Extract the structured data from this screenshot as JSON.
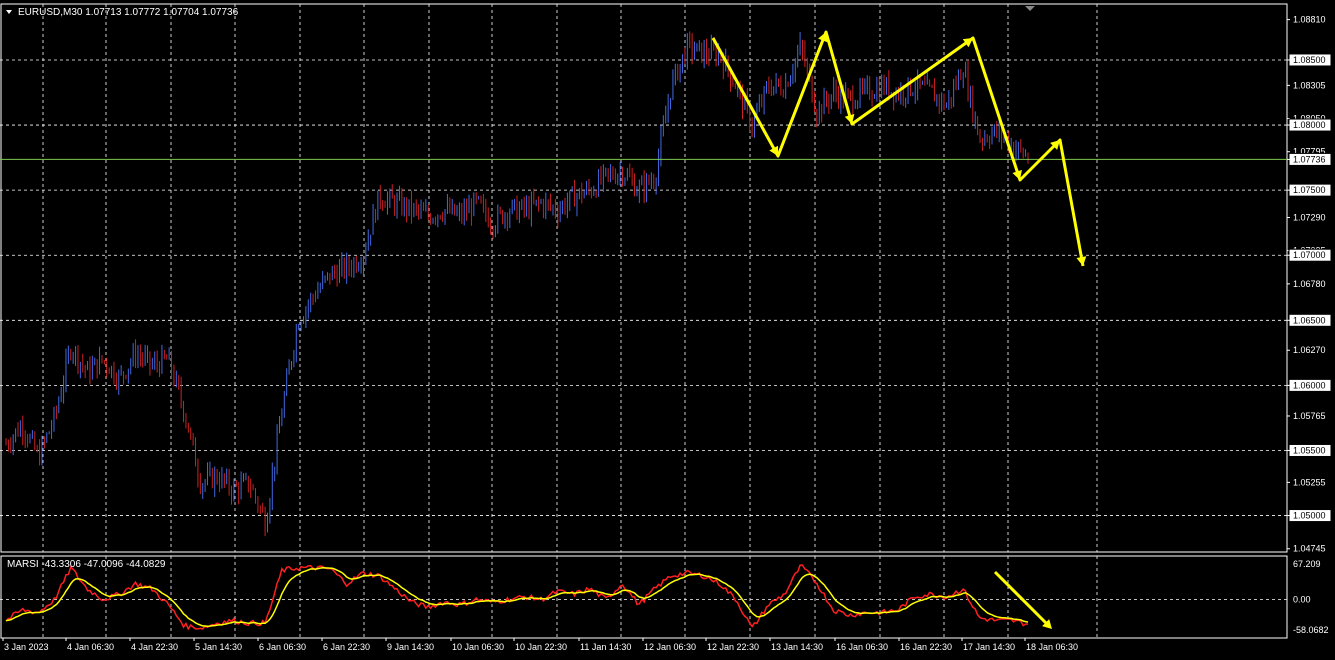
{
  "window": {
    "symbol_title": "EURUSD,M30",
    "ohlc": "1.07713 1.07772 1.07704 1.07736"
  },
  "colors": {
    "background": "#000000",
    "grid": "#ffffff",
    "bull_candle": "#4169e1",
    "bear_candle": "#cc2222",
    "price_line": "#7ec850",
    "annotation": "#ffff00",
    "osc_main": "#ff2020",
    "osc_signal": "#ffff00"
  },
  "price_axis": {
    "labels": [
      "1.08810",
      "1.08500",
      "1.08305",
      "1.08050",
      "1.08000",
      "1.07795",
      "1.07736",
      "1.07500",
      "1.07290",
      "1.07035",
      "1.07000",
      "1.06780",
      "1.06500",
      "1.06270",
      "1.06000",
      "1.05765",
      "1.05500",
      "1.05255",
      "1.05000",
      "1.04745"
    ],
    "current_price": "1.07736"
  },
  "oscillator": {
    "title": "MARSI",
    "values_text": "-43.3306 -47.0096 -44.0829",
    "axis_labels": [
      "67.209",
      "0.00",
      "-58.0682"
    ]
  },
  "time_axis": {
    "labels": [
      "3 Jan 2023",
      "4 Jan 06:30",
      "4 Jan 22:30",
      "5 Jan 14:30",
      "6 Jan 06:30",
      "6 Jan 22:30",
      "9 Jan 14:30",
      "10 Jan 06:30",
      "10 Jan 22:30",
      "11 Jan 14:30",
      "12 Jan 06:30",
      "12 Jan 22:30",
      "13 Jan 14:30",
      "16 Jan 06:30",
      "16 Jan 22:30",
      "17 Jan 14:30",
      "18 Jan 06:30"
    ]
  },
  "chart_data": {
    "type": "candlestick",
    "symbol": "EURUSD",
    "timeframe": "M30",
    "ylim": [
      1.0472,
      1.0893
    ],
    "price_path": [
      {
        "t": "3 Jan 2023",
        "price": 1.0555
      },
      {
        "t": "",
        "price": 1.057
      },
      {
        "t": "",
        "price": 1.0545
      },
      {
        "t": "",
        "price": 1.0575
      },
      {
        "t": "4 Jan 06:30",
        "price": 1.063
      },
      {
        "t": "",
        "price": 1.061
      },
      {
        "t": "",
        "price": 1.062
      },
      {
        "t": "",
        "price": 1.0605
      },
      {
        "t": "4 Jan 22:30",
        "price": 1.0625
      },
      {
        "t": "",
        "price": 1.0615
      },
      {
        "t": "",
        "price": 1.062
      },
      {
        "t": "",
        "price": 1.058
      },
      {
        "t": "5 Jan 14:30",
        "price": 1.0525
      },
      {
        "t": "",
        "price": 1.053
      },
      {
        "t": "",
        "price": 1.052
      },
      {
        "t": "",
        "price": 1.0525
      },
      {
        "t": "6 Jan 06:30",
        "price": 1.0495
      },
      {
        "t": "",
        "price": 1.058
      },
      {
        "t": "",
        "price": 1.065
      },
      {
        "t": "",
        "price": 1.067
      },
      {
        "t": "6 Jan 22:30",
        "price": 1.0685
      },
      {
        "t": "",
        "price": 1.069
      },
      {
        "t": "",
        "price": 1.07
      },
      {
        "t": "",
        "price": 1.0745
      },
      {
        "t": "9 Jan 14:30",
        "price": 1.074
      },
      {
        "t": "",
        "price": 1.0735
      },
      {
        "t": "",
        "price": 1.073
      },
      {
        "t": "",
        "price": 1.0735
      },
      {
        "t": "10 Jan 06:30",
        "price": 1.073
      },
      {
        "t": "",
        "price": 1.074
      },
      {
        "t": "",
        "price": 1.0725
      },
      {
        "t": "",
        "price": 1.0735
      },
      {
        "t": "10 Jan 22:30",
        "price": 1.0735
      },
      {
        "t": "",
        "price": 1.074
      },
      {
        "t": "",
        "price": 1.0735
      },
      {
        "t": "",
        "price": 1.0745
      },
      {
        "t": "11 Jan 14:30",
        "price": 1.075
      },
      {
        "t": "",
        "price": 1.076
      },
      {
        "t": "",
        "price": 1.0765
      },
      {
        "t": "",
        "price": 1.075
      },
      {
        "t": "12 Jan 06:30",
        "price": 1.076
      },
      {
        "t": "",
        "price": 1.083
      },
      {
        "t": "",
        "price": 1.086
      },
      {
        "t": "",
        "price": 1.0855
      },
      {
        "t": "12 Jan 22:30",
        "price": 1.0855
      },
      {
        "t": "",
        "price": 1.083
      },
      {
        "t": "",
        "price": 1.08
      },
      {
        "t": "",
        "price": 1.083
      },
      {
        "t": "13 Jan 14:30",
        "price": 1.083
      },
      {
        "t": "",
        "price": 1.086
      },
      {
        "t": "",
        "price": 1.081
      },
      {
        "t": "",
        "price": 1.0825
      },
      {
        "t": "16 Jan 06:30",
        "price": 1.082
      },
      {
        "t": "",
        "price": 1.0825
      },
      {
        "t": "",
        "price": 1.083
      },
      {
        "t": "",
        "price": 1.0825
      },
      {
        "t": "16 Jan 22:30",
        "price": 1.083
      },
      {
        "t": "",
        "price": 1.0825
      },
      {
        "t": "",
        "price": 1.0815
      },
      {
        "t": "",
        "price": 1.0845
      },
      {
        "t": "17 Jan 14:30",
        "price": 1.079
      },
      {
        "t": "",
        "price": 1.0795
      },
      {
        "t": "",
        "price": 1.0785
      },
      {
        "t": "",
        "price": 1.0775
      }
    ],
    "oscillator_path": [
      {
        "t": "3 Jan 2023",
        "value": -40
      },
      {
        "t": "",
        "value": -20
      },
      {
        "t": "",
        "value": -25
      },
      {
        "t": "",
        "value": 0
      },
      {
        "t": "4 Jan 06:30",
        "value": 60
      },
      {
        "t": "",
        "value": 20
      },
      {
        "t": "",
        "value": 0
      },
      {
        "t": "",
        "value": 10
      },
      {
        "t": "4 Jan 22:30",
        "value": 30
      },
      {
        "t": "",
        "value": 20
      },
      {
        "t": "",
        "value": -10
      },
      {
        "t": "",
        "value": -50
      },
      {
        "t": "5 Jan 14:30",
        "value": -55
      },
      {
        "t": "",
        "value": -45
      },
      {
        "t": "",
        "value": -40
      },
      {
        "t": "",
        "value": -45
      },
      {
        "t": "6 Jan 06:30",
        "value": -45
      },
      {
        "t": "",
        "value": 55
      },
      {
        "t": "",
        "value": 60
      },
      {
        "t": "",
        "value": 60
      },
      {
        "t": "6 Jan 22:30",
        "value": 58
      },
      {
        "t": "",
        "value": 30
      },
      {
        "t": "",
        "value": 50
      },
      {
        "t": "",
        "value": 45
      },
      {
        "t": "9 Jan 14:30",
        "value": 20
      },
      {
        "t": "",
        "value": -5
      },
      {
        "t": "",
        "value": -15
      },
      {
        "t": "",
        "value": -5
      },
      {
        "t": "10 Jan 06:30",
        "value": -10
      },
      {
        "t": "",
        "value": 0
      },
      {
        "t": "",
        "value": -5
      },
      {
        "t": "",
        "value": 0
      },
      {
        "t": "10 Jan 22:30",
        "value": 5
      },
      {
        "t": "",
        "value": 0
      },
      {
        "t": "",
        "value": 15
      },
      {
        "t": "",
        "value": 10
      },
      {
        "t": "11 Jan 14:30",
        "value": 20
      },
      {
        "t": "",
        "value": 0
      },
      {
        "t": "",
        "value": 30
      },
      {
        "t": "",
        "value": -10
      },
      {
        "t": "12 Jan 06:30",
        "value": 20
      },
      {
        "t": "",
        "value": 45
      },
      {
        "t": "",
        "value": 50
      },
      {
        "t": "",
        "value": 45
      },
      {
        "t": "12 Jan 22:30",
        "value": 30
      },
      {
        "t": "",
        "value": 0
      },
      {
        "t": "",
        "value": -55
      },
      {
        "t": "",
        "value": -10
      },
      {
        "t": "13 Jan 14:30",
        "value": 10
      },
      {
        "t": "",
        "value": 65
      },
      {
        "t": "",
        "value": 30
      },
      {
        "t": "",
        "value": -20
      },
      {
        "t": "16 Jan 06:30",
        "value": -30
      },
      {
        "t": "",
        "value": -25
      },
      {
        "t": "",
        "value": -25
      },
      {
        "t": "",
        "value": -20
      },
      {
        "t": "16 Jan 22:30",
        "value": 5
      },
      {
        "t": "",
        "value": 10
      },
      {
        "t": "",
        "value": 5
      },
      {
        "t": "",
        "value": 20
      },
      {
        "t": "17 Jan 14:30",
        "value": -35
      },
      {
        "t": "",
        "value": -40
      },
      {
        "t": "",
        "value": -40
      },
      {
        "t": "",
        "value": -47
      }
    ]
  }
}
